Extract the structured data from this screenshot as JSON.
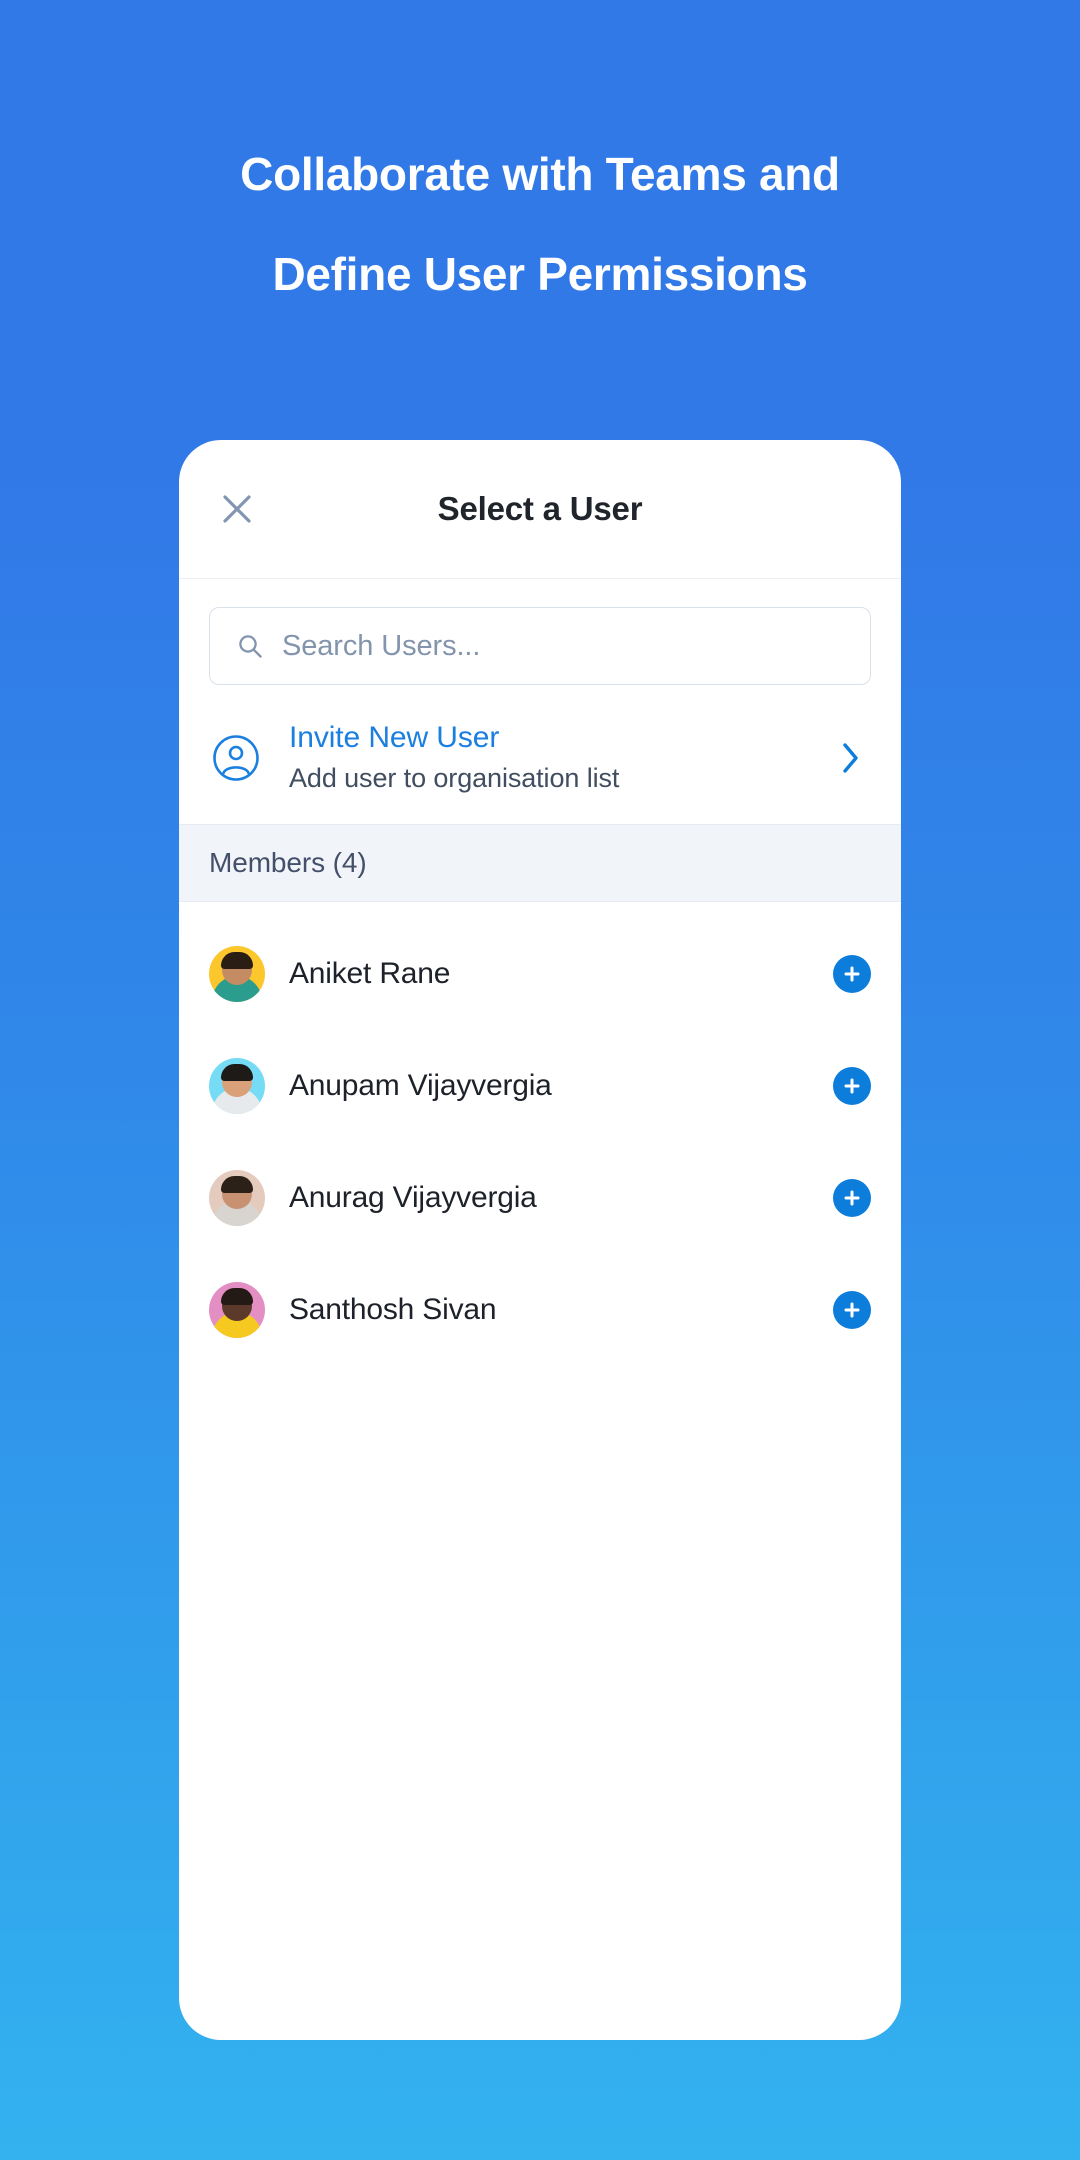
{
  "hero": {
    "line1": "Collaborate with Teams and",
    "line2": "Define User Permissions"
  },
  "modal": {
    "title": "Select a User",
    "close_icon": "close-icon",
    "search": {
      "placeholder": "Search Users...",
      "value": "",
      "icon": "search-icon"
    },
    "invite": {
      "icon": "user-circle-icon",
      "title": "Invite New User",
      "subtitle": "Add user to organisation list",
      "chevron_icon": "chevron-right-icon"
    },
    "members_header": "Members (4)",
    "members": [
      {
        "name": "Aniket Rane",
        "avatar_bg": "#fcc62d",
        "avatar_hair": "#2a1d14",
        "avatar_skin": "#c58b63",
        "avatar_body": "#2a9d8f",
        "action_icon": "plus-icon"
      },
      {
        "name": "Anupam Vijayvergia",
        "avatar_bg": "#76dcf5",
        "avatar_hair": "#1d1a17",
        "avatar_skin": "#d9a07a",
        "avatar_body": "#e7eaec",
        "action_icon": "plus-icon"
      },
      {
        "name": "Anurag Vijayvergia",
        "avatar_bg": "#e4cbbd",
        "avatar_hair": "#2b2118",
        "avatar_skin": "#c89272",
        "avatar_body": "#d8d4cf",
        "action_icon": "plus-icon"
      },
      {
        "name": "Santhosh Sivan",
        "avatar_bg": "#e48fc3",
        "avatar_hair": "#231a16",
        "avatar_skin": "#5b3a2b",
        "avatar_body": "#f5c91f",
        "action_icon": "plus-icon"
      }
    ]
  },
  "colors": {
    "background_top": "#3279e8",
    "background_bottom": "#33b2ef",
    "accent_blue": "#1b7fe0",
    "add_button": "#0d7ddb",
    "card_white": "#ffffff",
    "band_gray": "#f1f4f9"
  }
}
